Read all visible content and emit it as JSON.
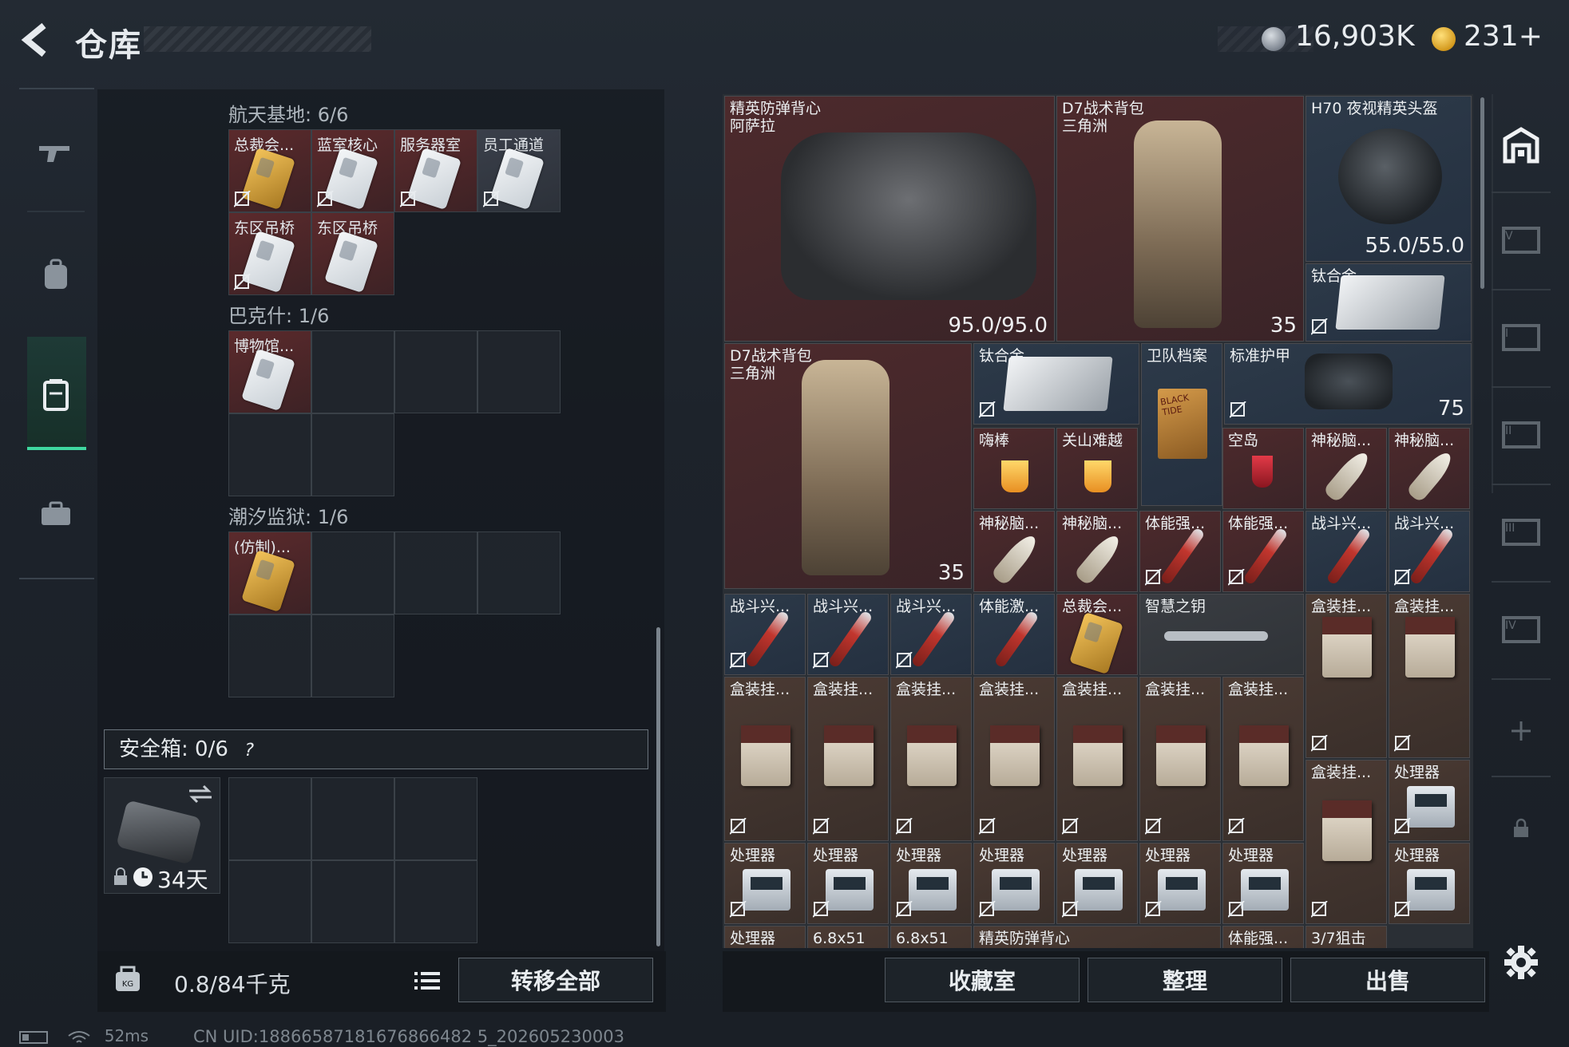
{
  "header": {
    "title": "仓库",
    "currency1": "16,903K",
    "currency2": "231+"
  },
  "left": {
    "sections": [
      {
        "title": "航天基地: 6/6",
        "items": [
          [
            "总裁会...",
            "蓝室核心",
            "服务器室",
            "员工通道"
          ],
          [
            "东区吊桥",
            "东区吊桥"
          ]
        ]
      },
      {
        "title": "巴克什: 1/6",
        "items": [
          [
            "博物馆..."
          ]
        ]
      },
      {
        "title": "潮汐监狱: 1/6",
        "items": [
          [
            "(仿制)..."
          ]
        ]
      }
    ],
    "safe_title": "安全箱:  0/6",
    "safe_help": "?",
    "safe_days": "34天",
    "weight": "0.8/84千克",
    "transfer": "转移全部"
  },
  "stash": {
    "big": [
      {
        "l": "精英防弹背心\n阿萨拉",
        "v": "95.0/95.0"
      },
      {
        "l": "D7战术背包\n三角洲",
        "v": "35"
      },
      {
        "l": "H70 夜视精英头盔",
        "v": "55.0/55.0"
      },
      {
        "l": "钛合金"
      },
      {
        "l": "D7战术背包\n三角洲",
        "v": "35"
      },
      {
        "l": "钛合金"
      },
      {
        "l": "卫队档案"
      },
      {
        "l": "标准护甲",
        "v": "75"
      }
    ],
    "row2": [
      "嗨棒",
      "关山难越",
      "空岛",
      "神秘脑...",
      "神秘脑..."
    ],
    "row3": [
      "神秘脑...",
      "神秘脑...",
      "体能强...",
      "体能强...",
      "战斗兴...",
      "战斗兴..."
    ],
    "row4": [
      "战斗兴...",
      "战斗兴...",
      "战斗兴...",
      "体能激...",
      "总裁会...",
      "智慧之钥",
      "盒装挂...",
      "盒装挂..."
    ],
    "row5": [
      "盒装挂...",
      "盒装挂...",
      "盒装挂...",
      "盒装挂...",
      "盒装挂...",
      "盒装挂...",
      "盒装挂..."
    ],
    "row5b": [
      "盒装挂...",
      "处理器"
    ],
    "row6": [
      "处理器",
      "处理器",
      "处理器",
      "处理器",
      "处理器",
      "处理器",
      "处理器",
      "处理器"
    ],
    "row7": [
      "处理器",
      "6.8x51",
      "6.8x51",
      "精英防弹背心",
      "体能强...",
      "3/7狙击"
    ],
    "book_text": "BLACK TIDE"
  },
  "buttons": {
    "collection": "收藏室",
    "sort": "整理",
    "sell": "出售"
  },
  "footer": {
    "ping": "52ms",
    "uid": "CN UID:18866587181676866482 5_202605230003"
  },
  "colors": {
    "accent": "#3fd8a0",
    "red_cell": "#4d2a2c",
    "blue_cell": "#2d3a49"
  }
}
